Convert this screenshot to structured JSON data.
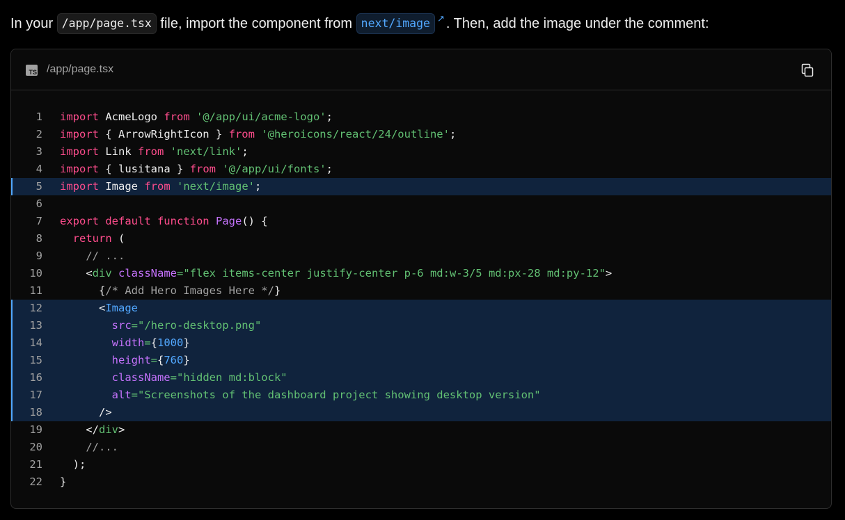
{
  "intro": {
    "before": "In your ",
    "file_code": "/app/page.tsx",
    "middle": " file, import the component from ",
    "link_code": "next/image",
    "link_arrow": "↗",
    "after": ". Then, add the image under the comment:"
  },
  "code_block": {
    "file_icon": "typescript-file-icon",
    "file_icon_label": "TS",
    "file_name": "/app/page.tsx",
    "copy_icon": "copy-icon",
    "highlighted_lines": [
      5,
      12,
      13,
      14,
      15,
      16,
      17,
      18
    ],
    "lines": [
      {
        "n": "1",
        "tokens": [
          [
            "kw",
            "import"
          ],
          [
            "p",
            " AcmeLogo "
          ],
          [
            "kw",
            "from"
          ],
          [
            "p",
            " "
          ],
          [
            "str",
            "'@/app/ui/acme-logo'"
          ],
          [
            "p",
            ";"
          ]
        ]
      },
      {
        "n": "2",
        "tokens": [
          [
            "kw",
            "import"
          ],
          [
            "p",
            " { ArrowRightIcon } "
          ],
          [
            "kw",
            "from"
          ],
          [
            "p",
            " "
          ],
          [
            "str",
            "'@heroicons/react/24/outline'"
          ],
          [
            "p",
            ";"
          ]
        ]
      },
      {
        "n": "3",
        "tokens": [
          [
            "kw",
            "import"
          ],
          [
            "p",
            " Link "
          ],
          [
            "kw",
            "from"
          ],
          [
            "p",
            " "
          ],
          [
            "str",
            "'next/link'"
          ],
          [
            "p",
            ";"
          ]
        ]
      },
      {
        "n": "4",
        "tokens": [
          [
            "kw",
            "import"
          ],
          [
            "p",
            " { lusitana } "
          ],
          [
            "kw",
            "from"
          ],
          [
            "p",
            " "
          ],
          [
            "str",
            "'@/app/ui/fonts'"
          ],
          [
            "p",
            ";"
          ]
        ]
      },
      {
        "n": "5",
        "tokens": [
          [
            "kw",
            "import"
          ],
          [
            "p",
            " Image "
          ],
          [
            "kw",
            "from"
          ],
          [
            "p",
            " "
          ],
          [
            "str",
            "'next/image'"
          ],
          [
            "p",
            ";"
          ]
        ]
      },
      {
        "n": "6",
        "tokens": [
          [
            "p",
            " "
          ]
        ]
      },
      {
        "n": "7",
        "tokens": [
          [
            "kw",
            "export default function"
          ],
          [
            "p",
            " "
          ],
          [
            "fn",
            "Page"
          ],
          [
            "p",
            "() {"
          ]
        ]
      },
      {
        "n": "8",
        "tokens": [
          [
            "p",
            "  "
          ],
          [
            "kw",
            "return"
          ],
          [
            "p",
            " ("
          ]
        ]
      },
      {
        "n": "9",
        "tokens": [
          [
            "p",
            "    "
          ],
          [
            "cm",
            "// ..."
          ]
        ]
      },
      {
        "n": "10",
        "tokens": [
          [
            "p",
            "    <"
          ],
          [
            "tag",
            "div"
          ],
          [
            "p",
            " "
          ],
          [
            "attr",
            "className"
          ],
          [
            "str",
            "=\"flex items-center justify-center p-6 md:w-3/5 md:px-28 md:py-12\""
          ],
          [
            "p",
            ">"
          ]
        ]
      },
      {
        "n": "11",
        "tokens": [
          [
            "p",
            "      {"
          ],
          [
            "cm",
            "/* Add Hero Images Here */"
          ],
          [
            "p",
            "}"
          ]
        ]
      },
      {
        "n": "12",
        "tokens": [
          [
            "p",
            "      <"
          ],
          [
            "tagc",
            "Image"
          ]
        ]
      },
      {
        "n": "13",
        "tokens": [
          [
            "p",
            "        "
          ],
          [
            "attr",
            "src"
          ],
          [
            "str",
            "=\"/hero-desktop.png\""
          ]
        ]
      },
      {
        "n": "14",
        "tokens": [
          [
            "p",
            "        "
          ],
          [
            "attr",
            "width"
          ],
          [
            "str",
            "="
          ],
          [
            "p",
            "{"
          ],
          [
            "num",
            "1000"
          ],
          [
            "p",
            "}"
          ]
        ]
      },
      {
        "n": "15",
        "tokens": [
          [
            "p",
            "        "
          ],
          [
            "attr",
            "height"
          ],
          [
            "str",
            "="
          ],
          [
            "p",
            "{"
          ],
          [
            "num",
            "760"
          ],
          [
            "p",
            "}"
          ]
        ]
      },
      {
        "n": "16",
        "tokens": [
          [
            "p",
            "        "
          ],
          [
            "attr",
            "className"
          ],
          [
            "str",
            "=\"hidden md:block\""
          ]
        ]
      },
      {
        "n": "17",
        "tokens": [
          [
            "p",
            "        "
          ],
          [
            "attr",
            "alt"
          ],
          [
            "str",
            "=\"Screenshots of the dashboard project showing desktop version\""
          ]
        ]
      },
      {
        "n": "18",
        "tokens": [
          [
            "p",
            "      />"
          ]
        ]
      },
      {
        "n": "19",
        "tokens": [
          [
            "p",
            "    </"
          ],
          [
            "tag",
            "div"
          ],
          [
            "p",
            ">"
          ]
        ]
      },
      {
        "n": "20",
        "tokens": [
          [
            "p",
            "    "
          ],
          [
            "cm",
            "//..."
          ]
        ]
      },
      {
        "n": "21",
        "tokens": [
          [
            "p",
            "  );"
          ]
        ]
      },
      {
        "n": "22",
        "tokens": [
          [
            "p",
            "}"
          ]
        ]
      }
    ]
  }
}
